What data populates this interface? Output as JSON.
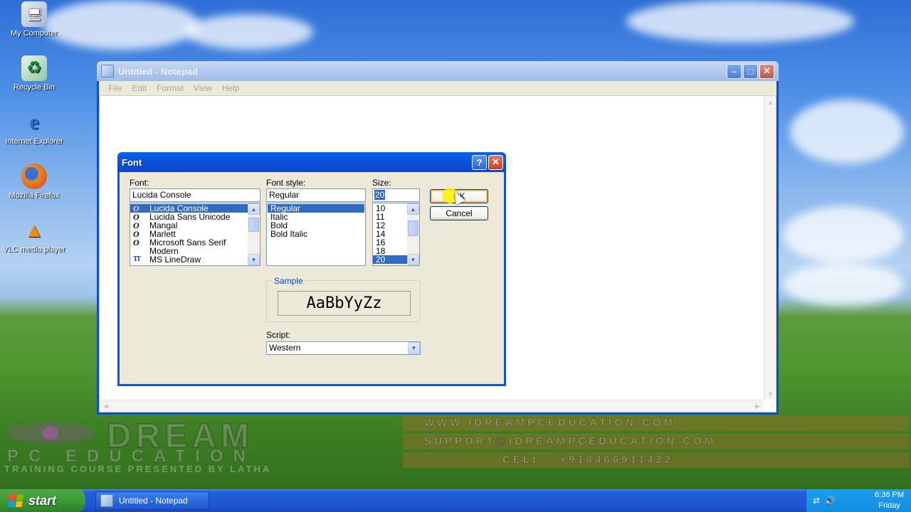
{
  "desktop": {
    "icons": [
      {
        "label": "My Computer",
        "icon": "computer-icon"
      },
      {
        "label": "Recycle Bin",
        "icon": "recycle-bin-icon"
      },
      {
        "label": "Internet Explorer",
        "icon": "ie-icon"
      },
      {
        "label": "Mozilla Firefox",
        "icon": "firefox-icon"
      },
      {
        "label": "VLC media player",
        "icon": "vlc-icon"
      }
    ]
  },
  "notepad": {
    "title": "Untitled - Notepad",
    "menu": [
      "File",
      "Edit",
      "Format",
      "View",
      "Help"
    ],
    "window_controls": {
      "minimize": "–",
      "maximize": "□",
      "close": "✕"
    }
  },
  "font_dialog": {
    "title": "Font",
    "help": "?",
    "close": "✕",
    "font_label": "Font:",
    "font_value": "Lucida Console",
    "fonts": [
      {
        "name": "Lucida Console",
        "type": "O",
        "selected": true
      },
      {
        "name": "Lucida Sans Unicode",
        "type": "O"
      },
      {
        "name": "Mangal",
        "type": "O"
      },
      {
        "name": "Marlett",
        "type": "O"
      },
      {
        "name": "Microsoft Sans Serif",
        "type": "O"
      },
      {
        "name": "Modern",
        "type": ""
      },
      {
        "name": "MS LineDraw",
        "type": "TT"
      }
    ],
    "style_label": "Font style:",
    "style_value": "Regular",
    "styles": [
      "Regular",
      "Italic",
      "Bold",
      "Bold Italic"
    ],
    "size_label": "Size:",
    "size_value": "20",
    "sizes": [
      "10",
      "11",
      "12",
      "14",
      "16",
      "18",
      "20"
    ],
    "ok_label": "OK",
    "cancel_label": "Cancel",
    "sample_legend": "Sample",
    "sample_text": "AaBbYyZz",
    "script_label": "Script:",
    "script_value": "Western"
  },
  "watermark": {
    "brand": "DREAM",
    "sub": "PC EDUCATION",
    "tagline": "TRAINING COURSE PRESENTED BY LATHA",
    "website": "WWW.IDREAMPCEDUCATION.COM",
    "support": "SUPPORT@IDREAMPCEDUCATION.COM",
    "cell": "CELL : +918466911422"
  },
  "taskbar": {
    "start_label": "start",
    "task_label": "Untitled - Notepad",
    "time": "6:36 PM",
    "day": "Friday"
  },
  "colors": {
    "xp_blue": "#0c55dc",
    "selection": "#316ac5",
    "start_green": "#3c9a37"
  }
}
